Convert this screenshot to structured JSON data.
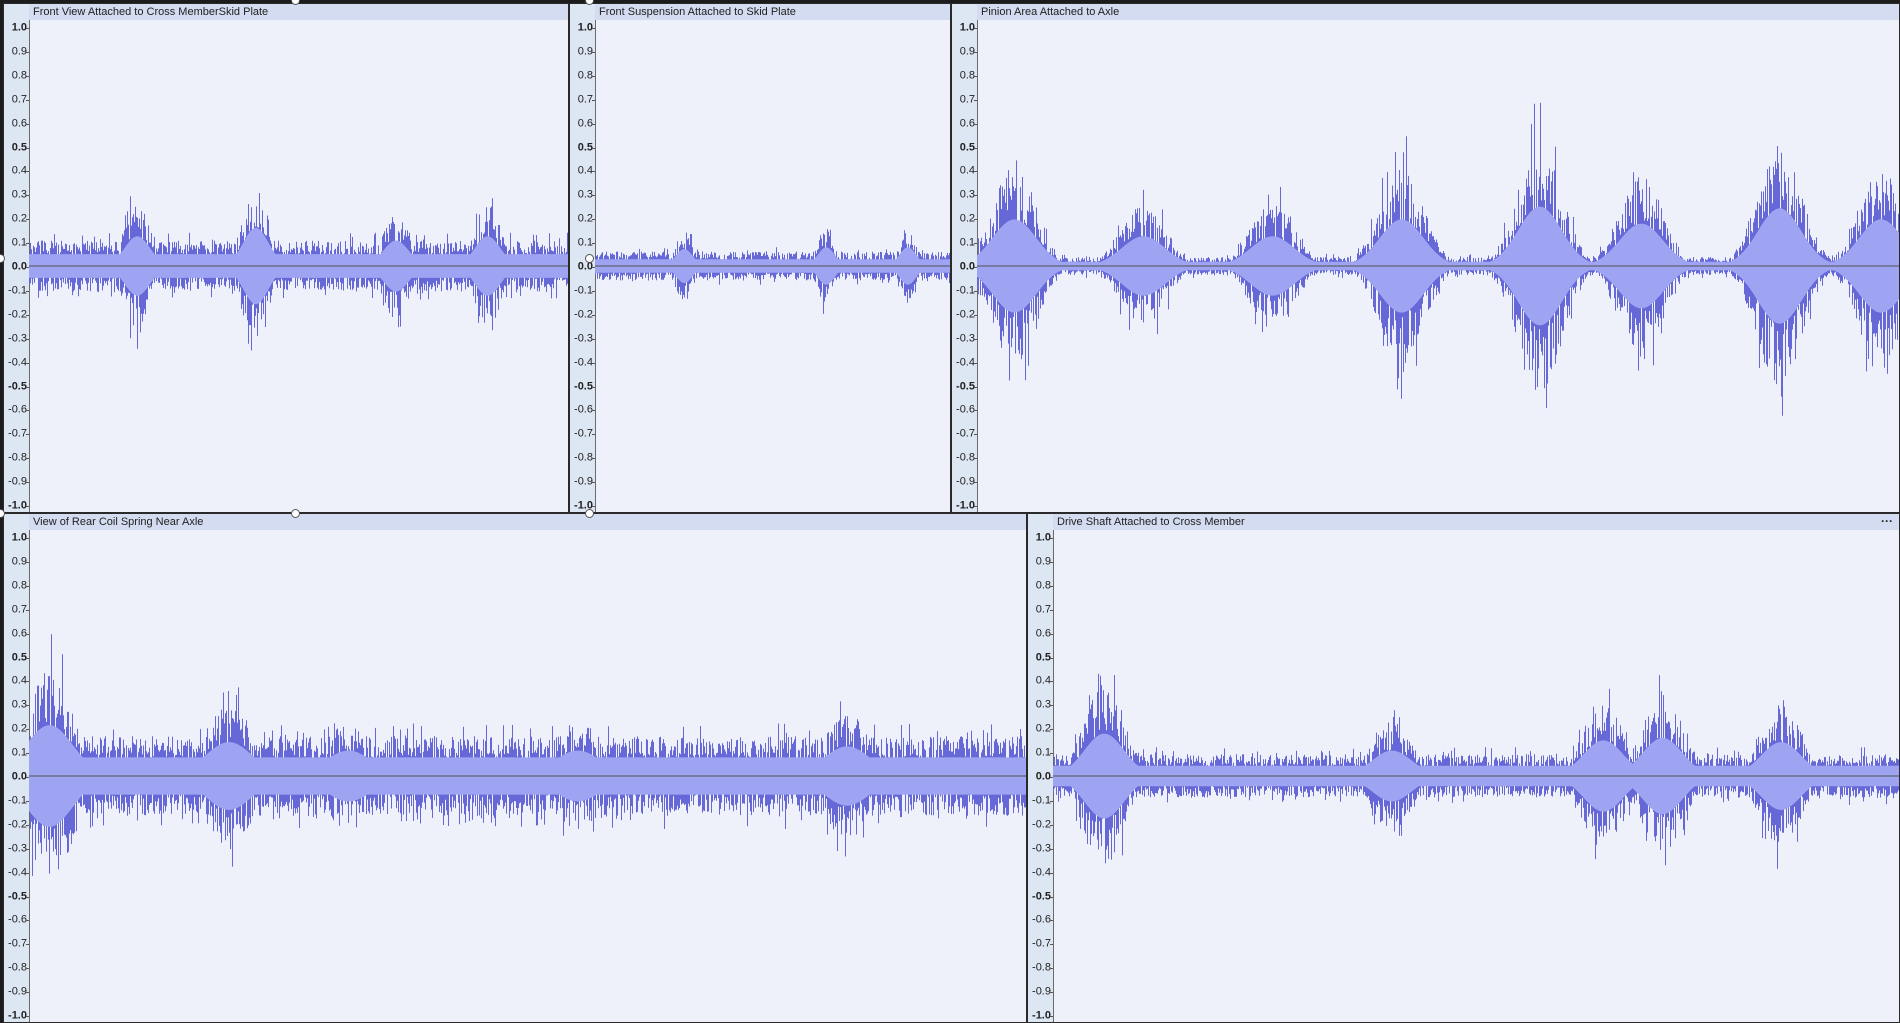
{
  "colors": {
    "wave": "#6668d8",
    "wave_light": "#9ea4f2",
    "background": "#eef0fa",
    "ruler": "#dde6f3",
    "title_bar": "#d3dcf0",
    "zero_line": "#505050"
  },
  "ruler_labels": [
    "1.0",
    "0.9",
    "0.8",
    "0.7",
    "0.6",
    "0.5",
    "0.4",
    "0.3",
    "0.2",
    "0.1",
    "0.0",
    "-0.1",
    "-0.2",
    "-0.3",
    "-0.4",
    "-0.5",
    "-0.6",
    "-0.7",
    "-0.8",
    "-0.9",
    "-1.0"
  ],
  "tracks": [
    {
      "name": "Front View Attached to Cross MemberSkid Plate",
      "amplitude": 0.4,
      "base": 0.14,
      "seed": 11,
      "peaks": [
        [
          0.2,
          0.35
        ],
        [
          0.42,
          0.45
        ],
        [
          0.68,
          0.3
        ],
        [
          0.85,
          0.35
        ]
      ]
    },
    {
      "name": "Front Suspension Attached to Skid Plate",
      "amplitude": 0.25,
      "base": 0.08,
      "seed": 23,
      "peaks": [
        [
          0.25,
          0.2
        ],
        [
          0.65,
          0.22
        ],
        [
          0.88,
          0.22
        ]
      ]
    },
    {
      "name": "Pinion Area Attached to Axle",
      "amplitude": 0.7,
      "base": 0.05,
      "seed": 37,
      "peaks": [
        [
          0.04,
          0.55
        ],
        [
          0.18,
          0.35
        ],
        [
          0.32,
          0.35
        ],
        [
          0.46,
          0.55
        ],
        [
          0.61,
          0.7
        ],
        [
          0.72,
          0.5
        ],
        [
          0.87,
          0.68
        ],
        [
          0.98,
          0.55
        ]
      ]
    },
    {
      "name": "View of Rear Coil Spring Near Axle",
      "amplitude": 0.45,
      "base": 0.22,
      "seed": 53,
      "peaks": [
        [
          0.02,
          0.6
        ],
        [
          0.2,
          0.4
        ],
        [
          0.32,
          0.3
        ],
        [
          0.55,
          0.3
        ],
        [
          0.82,
          0.35
        ]
      ]
    },
    {
      "name": "Drive Shaft Attached to Cross Member",
      "amplitude": 0.45,
      "base": 0.12,
      "seed": 71,
      "peaks": [
        [
          0.06,
          0.5
        ],
        [
          0.4,
          0.3
        ],
        [
          0.65,
          0.42
        ],
        [
          0.72,
          0.45
        ],
        [
          0.86,
          0.4
        ]
      ]
    }
  ],
  "menu_label": "···"
}
